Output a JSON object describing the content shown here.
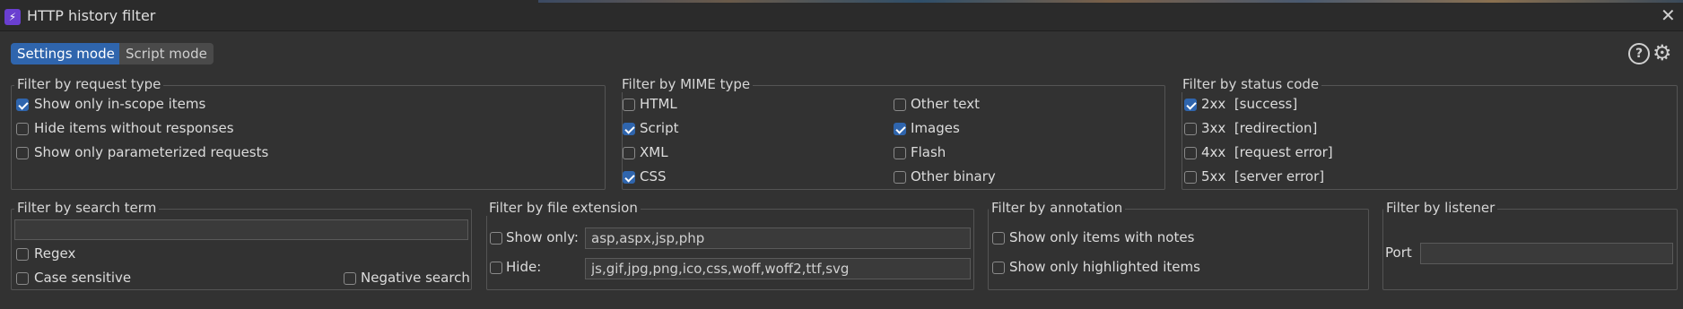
{
  "window": {
    "title": "HTTP history filter",
    "app_icon": "⚡"
  },
  "modes": {
    "settings": "Settings mode",
    "script": "Script mode"
  },
  "icons": {
    "help": "?",
    "gear": "⚙",
    "close": "✕"
  },
  "request_type": {
    "legend": "Filter by request type",
    "items": [
      {
        "label": "Show only in-scope items",
        "checked": true
      },
      {
        "label": "Hide items without responses",
        "checked": false
      },
      {
        "label": "Show only parameterized requests",
        "checked": false
      }
    ]
  },
  "mime": {
    "legend": "Filter by MIME type",
    "items": [
      {
        "label": "HTML",
        "checked": false
      },
      {
        "label": "Other text",
        "checked": false
      },
      {
        "label": "Script",
        "checked": true
      },
      {
        "label": "Images",
        "checked": true
      },
      {
        "label": "XML",
        "checked": false
      },
      {
        "label": "Flash",
        "checked": false
      },
      {
        "label": "CSS",
        "checked": true
      },
      {
        "label": "Other binary",
        "checked": false
      }
    ]
  },
  "status": {
    "legend": "Filter by status code",
    "items": [
      {
        "label": "2xx  [success]",
        "checked": true
      },
      {
        "label": "3xx  [redirection]",
        "checked": false
      },
      {
        "label": "4xx  [request error]",
        "checked": false
      },
      {
        "label": "5xx  [server error]",
        "checked": false
      }
    ]
  },
  "search": {
    "legend": "Filter by search term",
    "value": "",
    "regex": {
      "label": "Regex",
      "checked": false
    },
    "case_sensitive": {
      "label": "Case sensitive",
      "checked": false
    },
    "negative": {
      "label": "Negative search",
      "checked": false
    }
  },
  "extension": {
    "legend": "Filter by file extension",
    "show_only": {
      "label": "Show only:",
      "checked": false,
      "value": "asp,aspx,jsp,php"
    },
    "hide": {
      "label": "Hide:",
      "checked": false,
      "value": "js,gif,jpg,png,ico,css,woff,woff2,ttf,svg"
    }
  },
  "annotation": {
    "legend": "Filter by annotation",
    "items": [
      {
        "label": "Show only items with notes",
        "checked": false
      },
      {
        "label": "Show only highlighted items",
        "checked": false
      }
    ]
  },
  "listener": {
    "legend": "Filter by listener",
    "port_label": "Port",
    "port_value": ""
  }
}
